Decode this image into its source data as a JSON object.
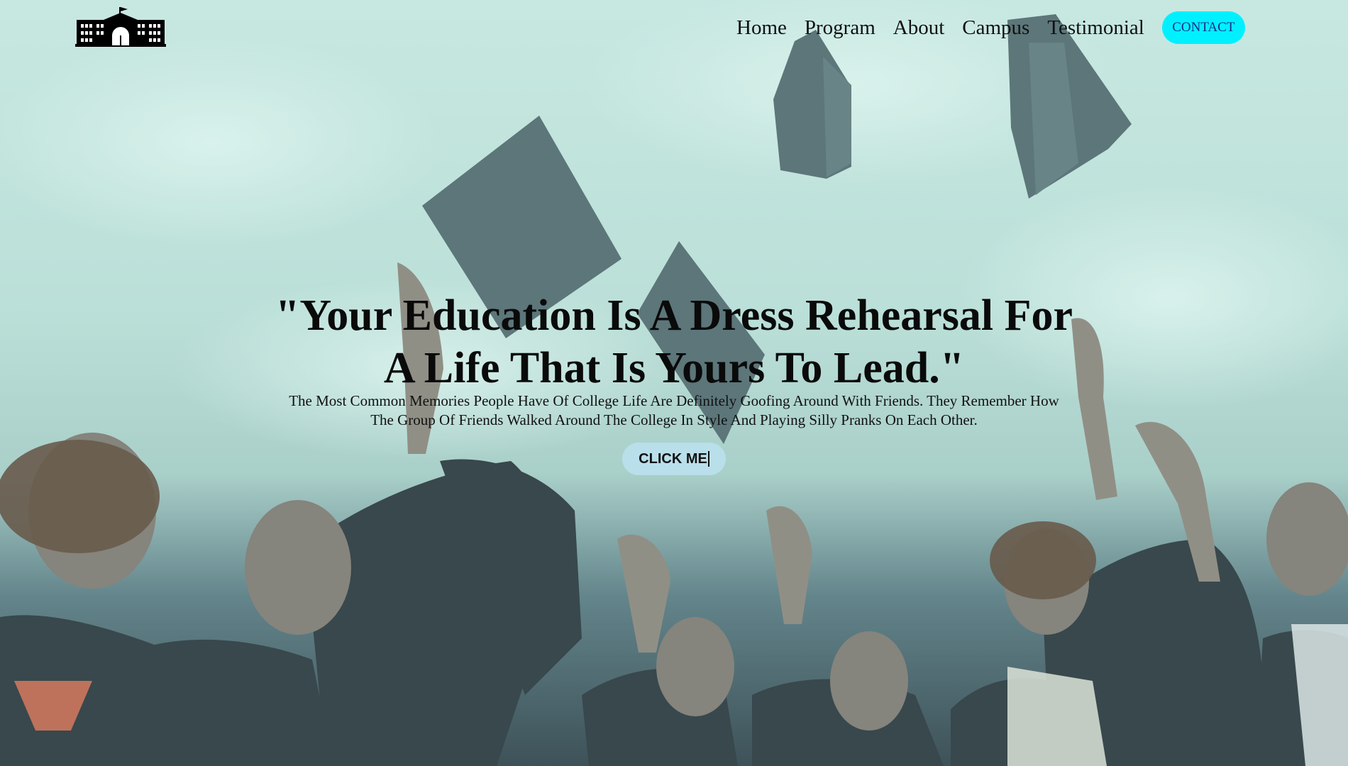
{
  "header": {
    "logo_icon": "school-building-icon",
    "nav_items": [
      {
        "label": "Home"
      },
      {
        "label": "Program"
      },
      {
        "label": "About"
      },
      {
        "label": "Campus"
      },
      {
        "label": "Testimonial"
      }
    ],
    "contact_label": "CONTACT"
  },
  "hero": {
    "headline_line1": "\"Your Education Is A Dress Rehearsal For",
    "headline_line2": "A Life That Is Yours To Lead.\"",
    "subtext_line1": "The Most Common Memories People Have Of College Life Are Definitely Goofing Around With Friends. They Remember How",
    "subtext_line2": "The Group Of Friends Walked Around The College In Style And Playing Silly Pranks On Each Other.",
    "cta_label": "CLICK ME",
    "background_image": "graduates-tossing-caps-photo"
  },
  "colors": {
    "contact_bg": "#00f0ff",
    "contact_text": "#1b2a8a",
    "cta_bg": "#b9dfea",
    "text": "#0a0a0a"
  }
}
